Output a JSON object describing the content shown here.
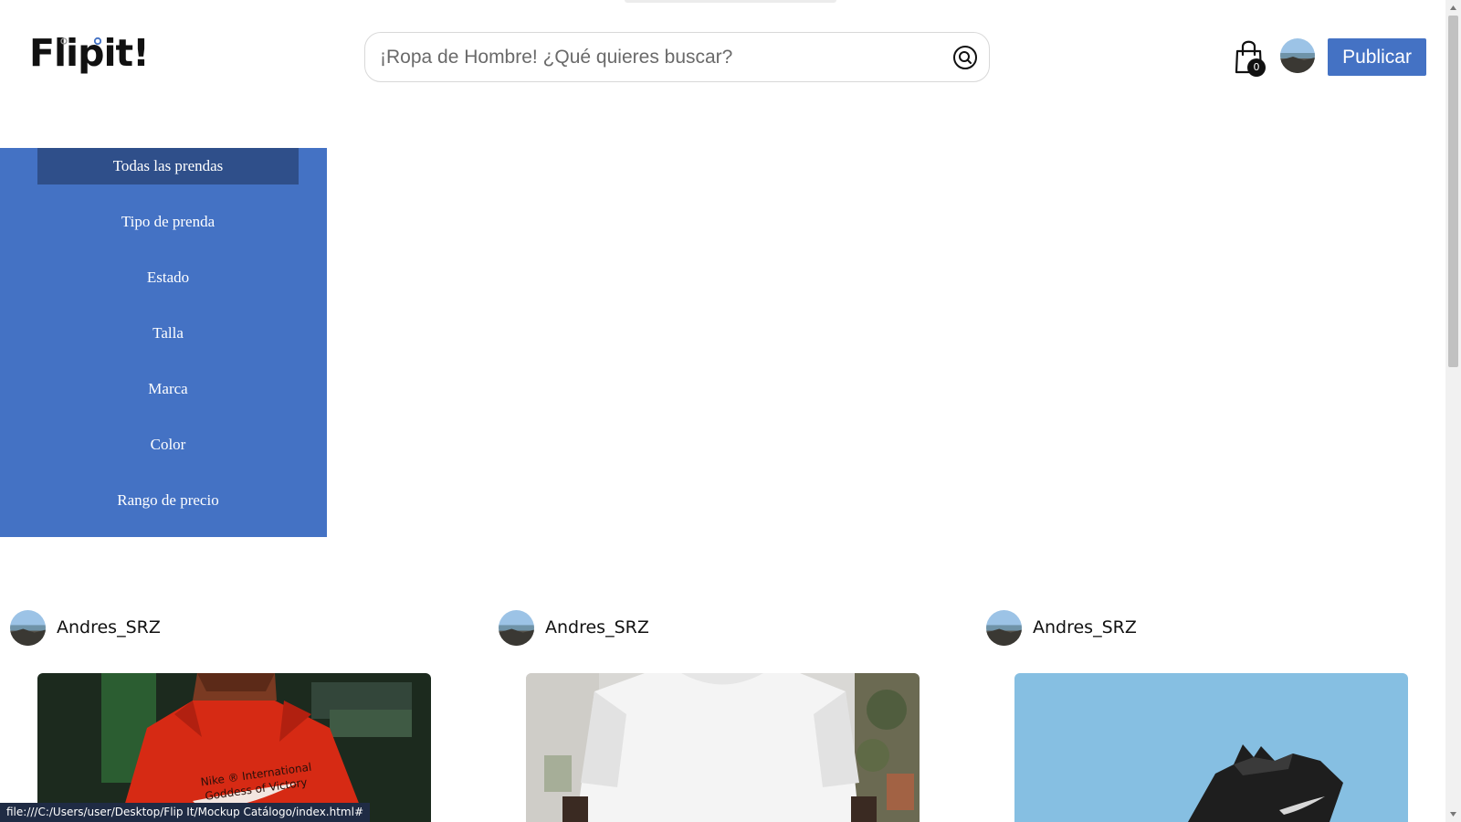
{
  "header": {
    "logo_text": "Flipit!",
    "search_placeholder": "¡Ropa de Hombre! ¿Qué quieres buscar?",
    "cart_count": "0",
    "publish_label": "Publicar"
  },
  "sidebar": {
    "items": [
      {
        "label": "Todas las prendas",
        "active": true
      },
      {
        "label": "Tipo de prenda"
      },
      {
        "label": "Estado"
      },
      {
        "label": "Talla"
      },
      {
        "label": "Marca"
      },
      {
        "label": "Color"
      },
      {
        "label": "Rango de precio"
      }
    ]
  },
  "products": [
    {
      "user": "Andres_SRZ",
      "image": "red-hoodie-photo",
      "image_text": [
        "Nike ® International",
        "Goddess of Victory"
      ]
    },
    {
      "user": "Andres_SRZ",
      "image": "white-tshirt-photo"
    },
    {
      "user": "Andres_SRZ",
      "image": "black-sneaker-photo"
    }
  ],
  "status_bar": {
    "url": "file:///C:/Users/user/Desktop/Flip It/Mockup Catálogo/index.html#"
  },
  "colors": {
    "accent": "#4472c4",
    "sidebar_active": "#2f4f8a",
    "status_bg": "#1f2b44"
  }
}
